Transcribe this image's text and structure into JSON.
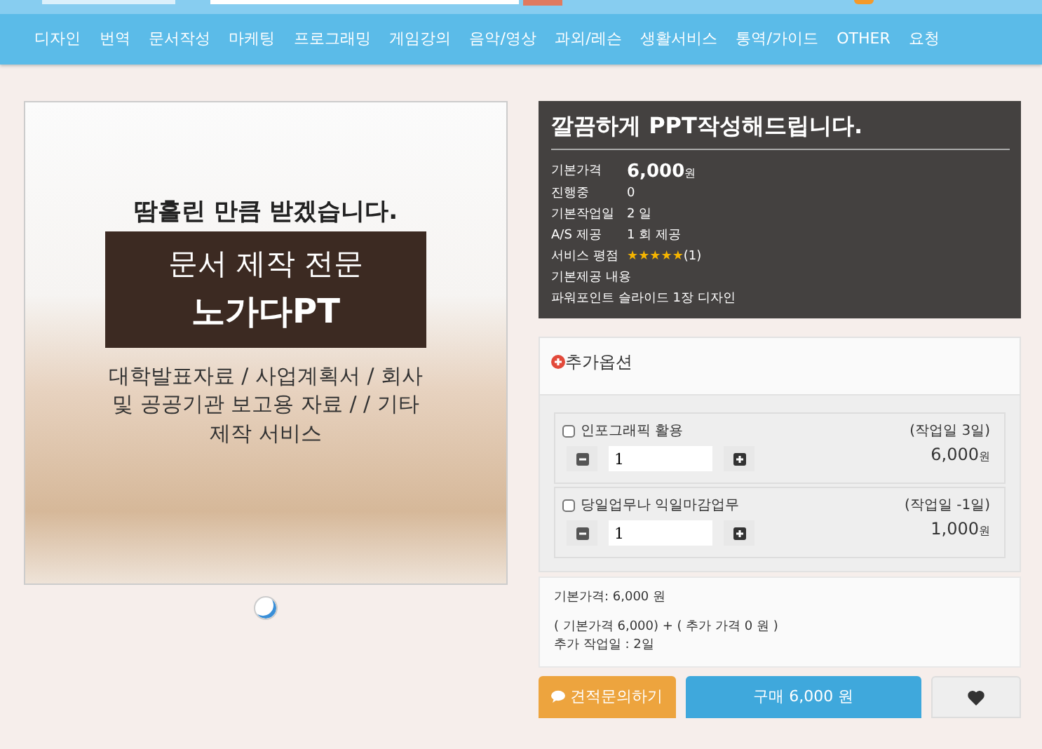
{
  "nav": {
    "items": [
      "디자인",
      "번역",
      "문서작성",
      "마케팅",
      "프로그래밍",
      "게임강의",
      "음악/영상",
      "과외/레슨",
      "생활서비스",
      "통역/가이드",
      "OTHER",
      "요청"
    ]
  },
  "product_image": {
    "tagline": "땀흘린 만큼 받겠습니다.",
    "banner_line_1": "문서 제작 전문",
    "banner_line_2": "노가다PT",
    "description": "대학발표자료 / 사업계획서 / 회사 및 공공기관 보고용 자료 / / 기타 제작 서비스"
  },
  "carousel": {
    "dots": [
      {
        "selected": true
      }
    ]
  },
  "service": {
    "title": "깔끔하게 PPT작성해드립니다.",
    "details": [
      {
        "kind": "price",
        "label": "기본가격",
        "value": "6,000",
        "unit": "원"
      },
      {
        "kind": "text",
        "label": "진행중",
        "value": "0"
      },
      {
        "kind": "text",
        "label": "기본작업일",
        "value": "2 일"
      },
      {
        "kind": "text",
        "label": "A/S 제공",
        "value": "1 회 제공"
      },
      {
        "kind": "rating",
        "label": "서비스 평점",
        "stars": 5,
        "count": "(1)"
      },
      {
        "kind": "text",
        "label": "기본제공 내용"
      },
      {
        "kind": "note",
        "label": "파워포인트 슬라이드 1장 디자인"
      }
    ]
  },
  "extra_options": {
    "title": "추가옵션",
    "options": [
      {
        "label": "인포그래픽 활용",
        "checked": false,
        "quantity": "1",
        "days": "(작업일 3일)",
        "price": "6,000",
        "unit": "원"
      },
      {
        "label": "당일업무나 익일마감업무",
        "checked": false,
        "quantity": "1",
        "days": "(작업일 -1일)",
        "price": "1,000",
        "unit": "원"
      }
    ]
  },
  "summary": {
    "base_price": "기본가격: 6,000 원",
    "formula": "( 기본가격 6,000) + ( 추가 가격 0 원 )",
    "extra_days": "추가 작업일 : 2일"
  },
  "actions": {
    "inquiry": "견적문의하기",
    "buy": "구매 6,000 원"
  }
}
